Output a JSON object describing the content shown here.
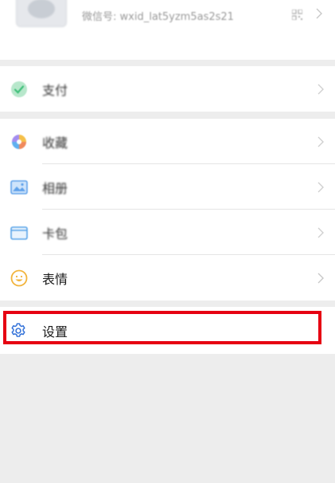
{
  "profile": {
    "wechat_id": "微信号: wxid_lat5yzm5as2s21"
  },
  "menu": {
    "pay": {
      "label": "支付",
      "icon": "wechat-pay-icon"
    },
    "favorites": {
      "label": "收藏",
      "icon": "favorites-icon"
    },
    "album": {
      "label": "相册",
      "icon": "album-icon"
    },
    "cards": {
      "label": "卡包",
      "icon": "card-wallet-icon"
    },
    "stickers": {
      "label": "表情",
      "icon": "emoji-icon"
    },
    "settings": {
      "label": "设置",
      "icon": "gear-icon"
    }
  },
  "colors": {
    "highlight": "#e60012",
    "background": "#ededed",
    "pay_green": "#07c160",
    "settings_blue": "#2f6fd8"
  }
}
